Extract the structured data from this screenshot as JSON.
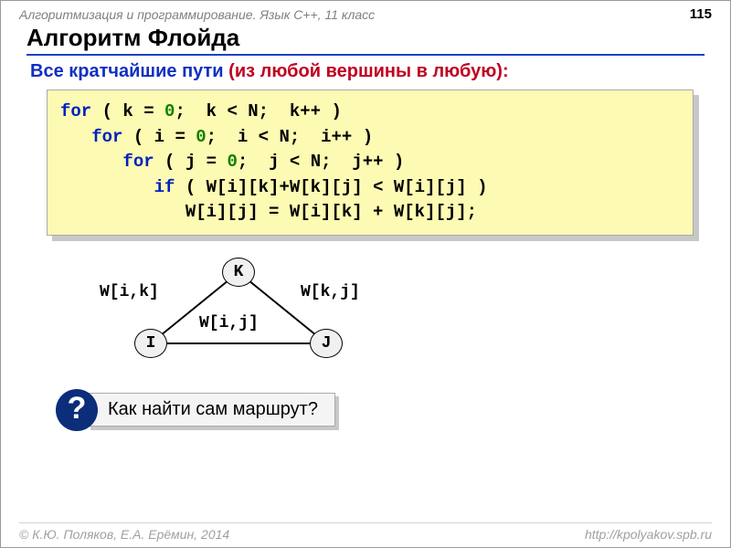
{
  "header": {
    "course": "Алгоритмизация и программирование. Язык C++, 11 класс",
    "page": "115"
  },
  "title": "Алгоритм Флойда",
  "subtitle": {
    "prefix": "Все кратчайшие пути ",
    "paren": "(из любой вершины в  любую):"
  },
  "code": {
    "l1": {
      "kw": "for",
      "rest1": " ( k = ",
      "num": "0",
      "rest2": ";  k < N;  k++ )"
    },
    "l2": {
      "indent": "   ",
      "kw": "for",
      "rest1": " ( i = ",
      "num": "0",
      "rest2": ";  i < N;  i++ )"
    },
    "l3": {
      "indent": "      ",
      "kw": "for",
      "rest1": " ( j = ",
      "num": "0",
      "rest2": ";  j < N;  j++ )"
    },
    "l4": {
      "indent": "         ",
      "kw": "if",
      "rest": " ( W[i][k]+W[k][j] < W[i][j] )"
    },
    "l5": {
      "indent": "            ",
      "rest": "W[i][j] = W[i][k] + W[k][j];"
    }
  },
  "graph": {
    "nodes": {
      "k": "K",
      "i": "I",
      "j": "J"
    },
    "edges": {
      "ik": "W[i,k]",
      "kj": "W[k,j]",
      "ij": "W[i,j]"
    }
  },
  "question": {
    "mark": "?",
    "text": "Как найти сам маршрут?"
  },
  "footer": {
    "left": "© К.Ю. Поляков, Е.А. Ерёмин, 2014",
    "right": "http://kpolyakov.spb.ru"
  }
}
